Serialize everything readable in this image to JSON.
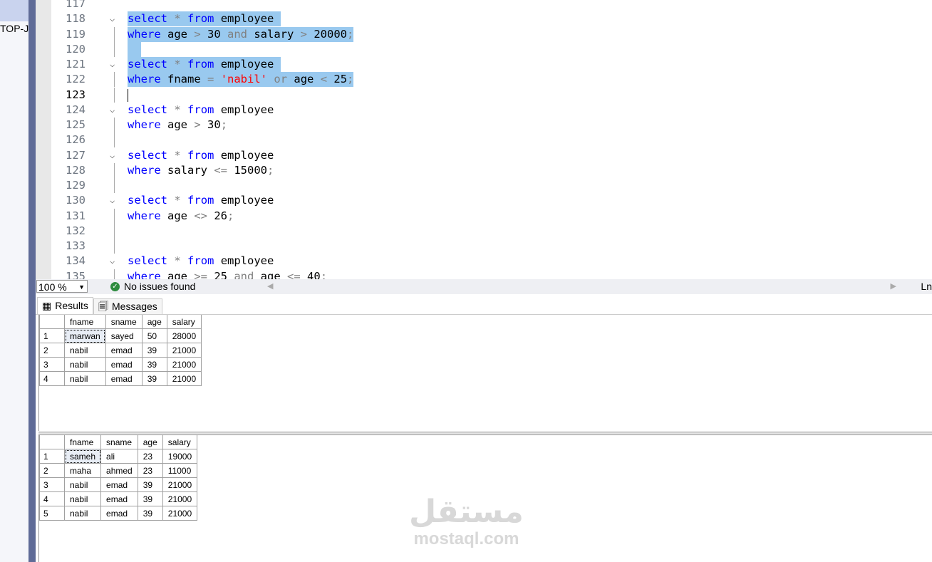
{
  "left_pane": {
    "server_label": "TOP-JN"
  },
  "editor": {
    "current_line": 123,
    "lines": [
      {
        "n": 117,
        "tokens": []
      },
      {
        "n": 118,
        "fold": true,
        "sel": true,
        "tokens": [
          [
            "k",
            "select"
          ],
          [
            "i",
            " "
          ],
          [
            "o",
            "*"
          ],
          [
            "i",
            " "
          ],
          [
            "k",
            "from"
          ],
          [
            "i",
            " employee "
          ]
        ]
      },
      {
        "n": 119,
        "sel": true,
        "tokens": [
          [
            "k",
            "where"
          ],
          [
            "i",
            " age "
          ],
          [
            "o",
            ">"
          ],
          [
            "i",
            " 30 "
          ],
          [
            "o",
            "and"
          ],
          [
            "i",
            " salary "
          ],
          [
            "o",
            ">"
          ],
          [
            "i",
            " 20000"
          ],
          [
            "o",
            ";"
          ]
        ]
      },
      {
        "n": 120,
        "sel": true,
        "tokens": [
          [
            "i",
            "  "
          ]
        ]
      },
      {
        "n": 121,
        "fold": true,
        "sel": true,
        "tokens": [
          [
            "k",
            "select"
          ],
          [
            "i",
            " "
          ],
          [
            "o",
            "*"
          ],
          [
            "i",
            " "
          ],
          [
            "k",
            "from"
          ],
          [
            "i",
            " employee "
          ]
        ]
      },
      {
        "n": 122,
        "sel": true,
        "tokens": [
          [
            "k",
            "where"
          ],
          [
            "i",
            " fname "
          ],
          [
            "o",
            "="
          ],
          [
            "i",
            " "
          ],
          [
            "s",
            "'nabil'"
          ],
          [
            "i",
            " "
          ],
          [
            "o",
            "or"
          ],
          [
            "i",
            " age "
          ],
          [
            "o",
            "<"
          ],
          [
            "i",
            " 25"
          ],
          [
            "o",
            ";"
          ]
        ]
      },
      {
        "n": 123,
        "tokens": []
      },
      {
        "n": 124,
        "fold": true,
        "tokens": [
          [
            "k",
            "select"
          ],
          [
            "i",
            " "
          ],
          [
            "o",
            "*"
          ],
          [
            "i",
            " "
          ],
          [
            "k",
            "from"
          ],
          [
            "i",
            " employee"
          ]
        ]
      },
      {
        "n": 125,
        "tokens": [
          [
            "k",
            "where"
          ],
          [
            "i",
            " age "
          ],
          [
            "o",
            ">"
          ],
          [
            "i",
            " 30"
          ],
          [
            "o",
            ";"
          ]
        ]
      },
      {
        "n": 126,
        "tokens": []
      },
      {
        "n": 127,
        "fold": true,
        "tokens": [
          [
            "k",
            "select"
          ],
          [
            "i",
            " "
          ],
          [
            "o",
            "*"
          ],
          [
            "i",
            " "
          ],
          [
            "k",
            "from"
          ],
          [
            "i",
            " employee"
          ]
        ]
      },
      {
        "n": 128,
        "tokens": [
          [
            "k",
            "where"
          ],
          [
            "i",
            " salary "
          ],
          [
            "o",
            "<="
          ],
          [
            "i",
            " 15000"
          ],
          [
            "o",
            ";"
          ]
        ]
      },
      {
        "n": 129,
        "tokens": []
      },
      {
        "n": 130,
        "fold": true,
        "tokens": [
          [
            "k",
            "select"
          ],
          [
            "i",
            " "
          ],
          [
            "o",
            "*"
          ],
          [
            "i",
            " "
          ],
          [
            "k",
            "from"
          ],
          [
            "i",
            " employee"
          ]
        ]
      },
      {
        "n": 131,
        "tokens": [
          [
            "k",
            "where"
          ],
          [
            "i",
            " age "
          ],
          [
            "o",
            "<>"
          ],
          [
            "i",
            " 26"
          ],
          [
            "o",
            ";"
          ]
        ]
      },
      {
        "n": 132,
        "tokens": []
      },
      {
        "n": 133,
        "tokens": []
      },
      {
        "n": 134,
        "fold": true,
        "tokens": [
          [
            "k",
            "select"
          ],
          [
            "i",
            " "
          ],
          [
            "o",
            "*"
          ],
          [
            "i",
            " "
          ],
          [
            "k",
            "from"
          ],
          [
            "i",
            " employee"
          ]
        ]
      },
      {
        "n": 135,
        "tokens": [
          [
            "k",
            "where"
          ],
          [
            "i",
            " age "
          ],
          [
            "o",
            ">="
          ],
          [
            "i",
            " 25 "
          ],
          [
            "o",
            "and"
          ],
          [
            "i",
            " age "
          ],
          [
            "o",
            "<="
          ],
          [
            "i",
            " 40"
          ],
          [
            "o",
            ";"
          ]
        ]
      }
    ]
  },
  "status": {
    "zoom": "100 %",
    "issues": "No issues found",
    "position_label": "Ln"
  },
  "tabs": [
    {
      "label": "Results",
      "icon": "grid-icon"
    },
    {
      "label": "Messages",
      "icon": "messages-icon"
    }
  ],
  "results": [
    {
      "columns": [
        "fname",
        "sname",
        "age",
        "salary"
      ],
      "rows": [
        [
          "1",
          "marwan",
          "sayed",
          "50",
          "28000"
        ],
        [
          "2",
          "nabil",
          "emad",
          "39",
          "21000"
        ],
        [
          "3",
          "nabil",
          "emad",
          "39",
          "21000"
        ],
        [
          "4",
          "nabil",
          "emad",
          "39",
          "21000"
        ]
      ]
    },
    {
      "columns": [
        "fname",
        "sname",
        "age",
        "salary"
      ],
      "rows": [
        [
          "1",
          "sameh",
          "ali",
          "23",
          "19000"
        ],
        [
          "2",
          "maha",
          "ahmed",
          "23",
          "11000"
        ],
        [
          "3",
          "nabil",
          "emad",
          "39",
          "21000"
        ],
        [
          "4",
          "nabil",
          "emad",
          "39",
          "21000"
        ],
        [
          "5",
          "nabil",
          "emad",
          "39",
          "21000"
        ]
      ]
    }
  ],
  "watermark": {
    "arabic": "مستقل",
    "latin": "mostaql.com"
  },
  "colors": {
    "keyword": "#0000ff",
    "operator": "#808080",
    "string": "#ff0000",
    "selection": "#99c9ef"
  }
}
